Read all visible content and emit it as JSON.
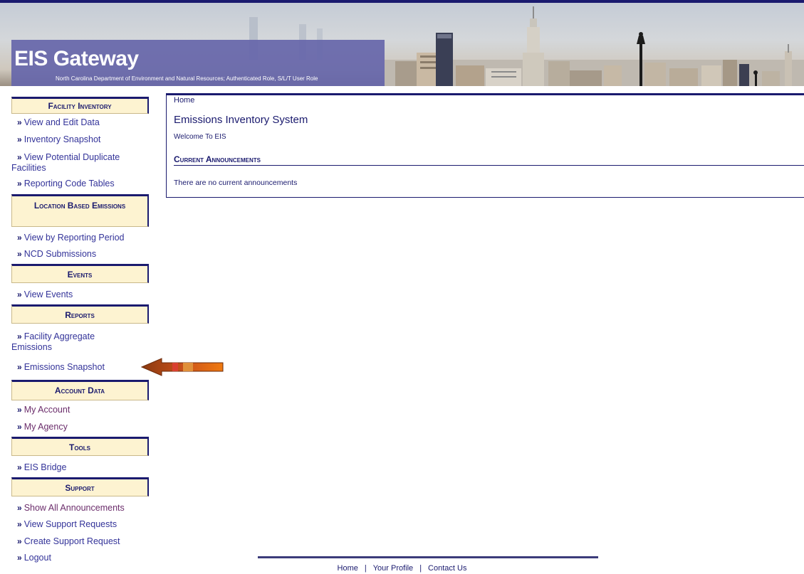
{
  "banner": {
    "title": "EIS Gateway",
    "subtitle": "North Carolina Department of Environment and Natural Resources; Authenticated Role, S/L/T User Role"
  },
  "sidebar": {
    "sections": [
      {
        "label": "Facility Inventory",
        "items": [
          {
            "label": "View and Edit Data"
          },
          {
            "label": "Inventory Snapshot"
          },
          {
            "label": "View Potential Duplicate Facilities"
          },
          {
            "label": "Reporting Code Tables"
          }
        ]
      },
      {
        "label": "Location Based Emissions",
        "items": [
          {
            "label": "View by Reporting Period"
          },
          {
            "label": "NCD Submissions"
          }
        ]
      },
      {
        "label": "Events",
        "items": [
          {
            "label": "View Events"
          }
        ]
      },
      {
        "label": "Reports",
        "items": [
          {
            "label": "Facility Aggregate Emissions"
          },
          {
            "label": "Emissions Snapshot"
          }
        ]
      },
      {
        "label": "Account Data",
        "items": [
          {
            "label": "My Account"
          },
          {
            "label": "My Agency"
          }
        ]
      },
      {
        "label": "Tools",
        "items": [
          {
            "label": "EIS Bridge"
          }
        ]
      },
      {
        "label": "Support",
        "items": [
          {
            "label": "Show All Announcements"
          },
          {
            "label": "View Support Requests"
          },
          {
            "label": "Create Support Request"
          },
          {
            "label": "Logout"
          }
        ]
      }
    ],
    "bullet": "»"
  },
  "main": {
    "breadcrumb": "Home",
    "title": "Emissions Inventory System",
    "welcome": "Welcome To EIS",
    "announcements_heading": "Current Announcements",
    "announcements_empty": "There are no current announcements"
  },
  "footer": {
    "links": [
      "Home",
      "Your Profile",
      "Contact Us"
    ],
    "separator": "|"
  },
  "colors": {
    "navy": "#1a1a6e",
    "section_bg": "#fdf3d1",
    "link": "#333399",
    "visited": "#6b2d6b",
    "arrow": "#e06a10"
  }
}
